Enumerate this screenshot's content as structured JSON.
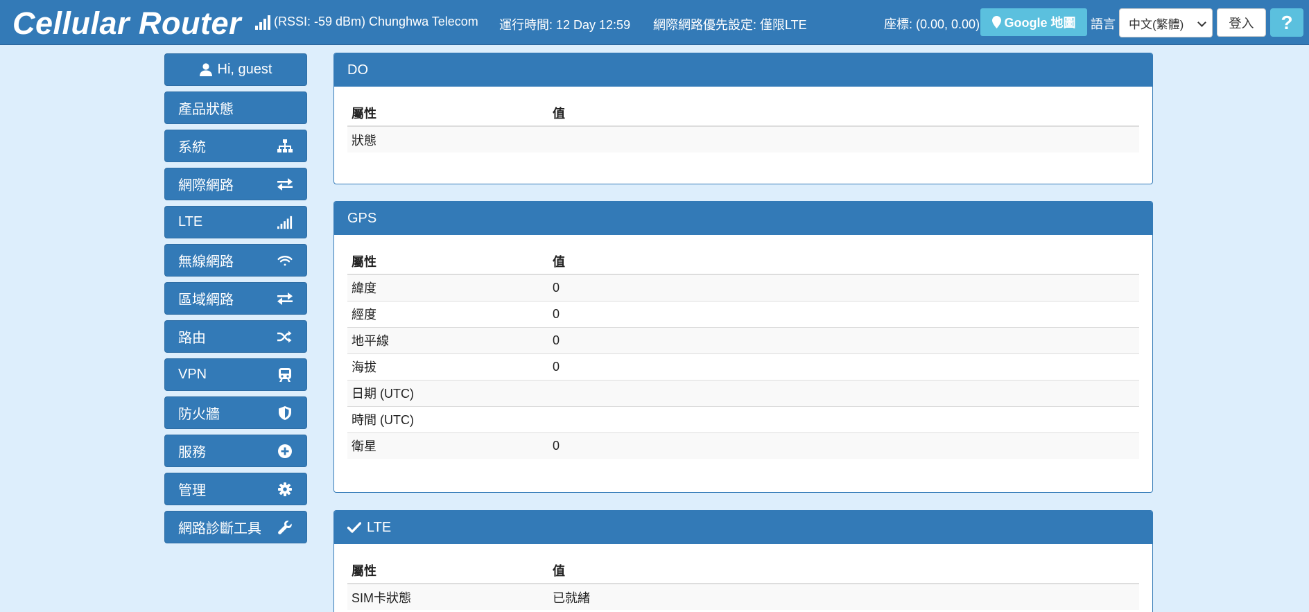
{
  "header": {
    "brand": "Cellular Router",
    "signal_text": "(RSSI: -59 dBm) Chunghwa Telecom",
    "uptime": "運行時間: 12 Day 12:59",
    "network_priority": "網際網路優先設定: 僅限LTE",
    "coordinates": "座標: (0.00, 0.00)",
    "google_map_label": "Google 地圖",
    "language_label": "語言",
    "language_value": "中文(繁體)",
    "login_label": "登入",
    "help_label": "?"
  },
  "sidebar": {
    "greeting": "Hi, guest",
    "items": [
      {
        "label": "產品狀態",
        "icon": "none"
      },
      {
        "label": "系統",
        "icon": "sitemap-icon"
      },
      {
        "label": "網際網路",
        "icon": "exchange-icon"
      },
      {
        "label": "LTE",
        "icon": "signal-icon"
      },
      {
        "label": "無線網路",
        "icon": "wifi-icon"
      },
      {
        "label": "區域網路",
        "icon": "exchange-icon"
      },
      {
        "label": "路由",
        "icon": "random-icon"
      },
      {
        "label": "VPN",
        "icon": "train-icon"
      },
      {
        "label": "防火牆",
        "icon": "shield-icon"
      },
      {
        "label": "服務",
        "icon": "plus-circle-icon"
      },
      {
        "label": "管理",
        "icon": "gear-icon"
      },
      {
        "label": "網路診斷工具",
        "icon": "wrench-icon"
      }
    ]
  },
  "panels": {
    "do": {
      "title": "DO",
      "columns": [
        "屬性",
        "值"
      ],
      "rows": [
        {
          "attr": "狀態",
          "value": ""
        }
      ]
    },
    "gps": {
      "title": "GPS",
      "columns": [
        "屬性",
        "值"
      ],
      "rows": [
        {
          "attr": "緯度",
          "value": "0"
        },
        {
          "attr": "經度",
          "value": "0"
        },
        {
          "attr": "地平線",
          "value": "0"
        },
        {
          "attr": "海拔",
          "value": "0"
        },
        {
          "attr": "日期 (UTC)",
          "value": ""
        },
        {
          "attr": "時間 (UTC)",
          "value": ""
        },
        {
          "attr": "衛星",
          "value": "0"
        }
      ]
    },
    "lte": {
      "title": "LTE",
      "columns": [
        "屬性",
        "值"
      ],
      "rows": [
        {
          "attr": "SIM卡狀態",
          "value": "已就緒"
        }
      ]
    }
  },
  "colors": {
    "primary": "#337ab7",
    "info": "#5bc0de",
    "background": "#ddeefc"
  }
}
